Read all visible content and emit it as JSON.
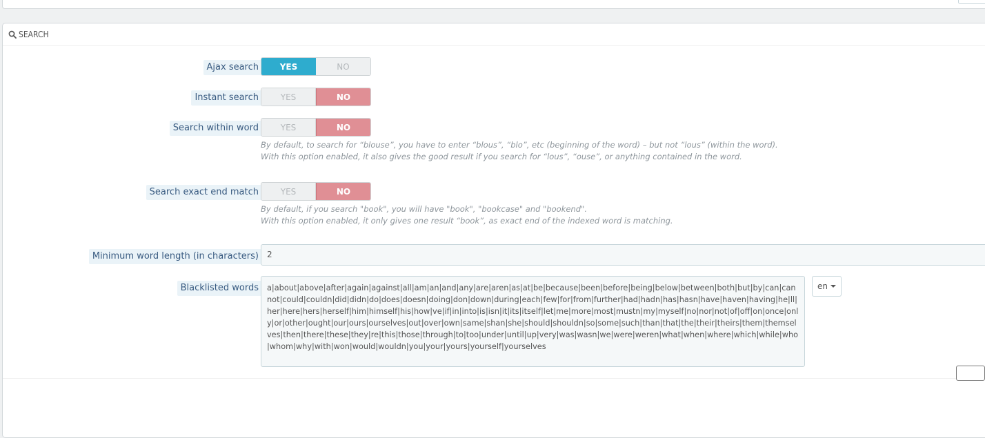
{
  "panel": {
    "title": "SEARCH"
  },
  "switch_labels": {
    "yes": "YES",
    "no": "NO"
  },
  "fields": {
    "ajax_search": {
      "label": "Ajax search",
      "value": "YES"
    },
    "instant_search": {
      "label": "Instant search",
      "value": "NO"
    },
    "search_within_word": {
      "label": "Search within word",
      "value": "NO",
      "help_1": "By default, to search for “blouse”, you have to enter “blous”, “blo”, etc (beginning of the word) – but not “lous” (within the word).",
      "help_2": "With this option enabled, it also gives the good result if you search for “lous”, “ouse”, or anything contained in the word."
    },
    "search_exact_end_match": {
      "label": "Search exact end match",
      "value": "NO",
      "help_1": "By default, if you search \"book\", you will have \"book\", \"bookcase\" and \"bookend\".",
      "help_2": "With this option enabled, it only gives one result “book”, as exact end of the indexed word is matching."
    },
    "min_word_length": {
      "label": "Minimum word length (in characters)",
      "value": "2"
    },
    "blacklisted_words": {
      "label": "Blacklisted words",
      "value": "a|about|above|after|again|against|all|am|an|and|any|are|aren|as|at|be|because|been|before|being|below|between|both|but|by|can|cannot|could|couldn|did|didn|do|does|doesn|doing|don|down|during|each|few|for|from|further|had|hadn|has|hasn|have|haven|having|he|ll|her|here|hers|herself|him|himself|his|how|ve|if|in|into|is|isn|it|its|itself|let|me|more|most|mustn|my|myself|no|nor|not|of|off|on|once|only|or|other|ought|our|ours|ourselves|out|over|own|same|shan|she|should|shouldn|so|some|such|than|that|the|their|theirs|them|themselves|then|there|these|they|re|this|those|through|to|too|under|until|up|very|was|wasn|we|were|weren|what|when|where|which|while|who|whom|why|with|won|would|wouldn|you|your|yours|yourself|yourselves",
      "language": "en"
    }
  },
  "icons": {
    "heading": "search-icon",
    "language": "caret-down-icon"
  },
  "colors": {
    "yes_active": "#2eacce",
    "no_active": "#e08f95",
    "label_text": "#385a80"
  }
}
